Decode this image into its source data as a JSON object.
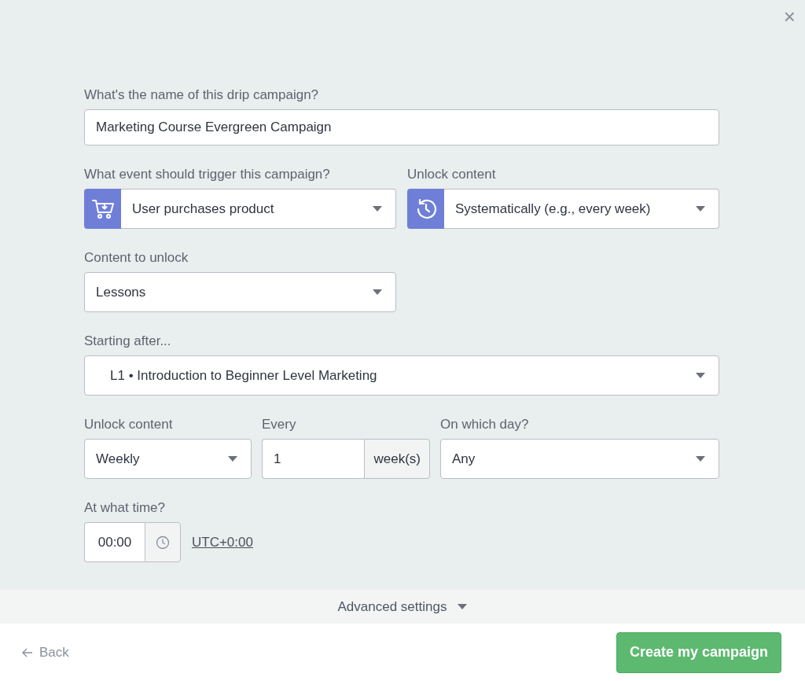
{
  "close_button": "×",
  "campaign_name": {
    "label": "What's the name of this drip campaign?",
    "value": "Marketing Course Evergreen Campaign"
  },
  "trigger": {
    "label": "What event should trigger this campaign?",
    "value": "User purchases product"
  },
  "unlock_method": {
    "label": "Unlock content",
    "value": "Systematically (e.g., every week)"
  },
  "content_to_unlock": {
    "label": "Content to unlock",
    "value": "Lessons"
  },
  "starting_after": {
    "label": "Starting after...",
    "value": "L1 • Introduction to Beginner Level Marketing"
  },
  "frequency": {
    "label": "Unlock content",
    "value": "Weekly"
  },
  "every": {
    "label": "Every",
    "value": "1",
    "unit": "week(s)"
  },
  "day": {
    "label": "On which day?",
    "value": "Any"
  },
  "time": {
    "label": "At what time?",
    "value": "00:00",
    "timezone": "UTC+0:00"
  },
  "advanced_settings": {
    "label": "Advanced settings",
    "expanded": false
  },
  "footer": {
    "back": "Back",
    "submit": "Create my campaign"
  }
}
